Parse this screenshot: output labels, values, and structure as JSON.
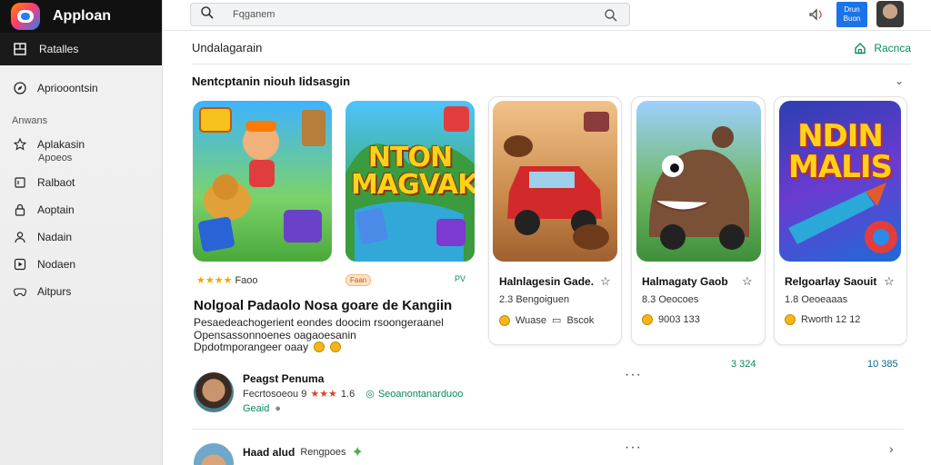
{
  "brand": {
    "name": "Apploan"
  },
  "search": {
    "placeholder": "Fqganem"
  },
  "topbar": {
    "button_label": "Drun\nBuon"
  },
  "sidebar": {
    "top": {
      "label": "Ratalles",
      "icon": "grid-icon"
    },
    "items": [
      {
        "label": "Apriooontsin",
        "icon": "compass-icon"
      }
    ],
    "section": "Anwans",
    "sub_items": [
      {
        "label": "Aplakasin",
        "sub": "Apoeos",
        "icon": "star-icon"
      },
      {
        "label": "Ralbaot",
        "icon": "bookmark-icon"
      },
      {
        "label": "Aoptain",
        "icon": "lock-icon"
      },
      {
        "label": "Nadain",
        "icon": "person-icon"
      },
      {
        "label": "Nodaen",
        "icon": "play-box-icon"
      },
      {
        "label": "Aitpurs",
        "icon": "gamepad-icon"
      }
    ]
  },
  "header": {
    "title": "Undalagarain",
    "action": "Racnca"
  },
  "section": {
    "title": "Nentcptanin niouh Iidsasgin",
    "more": "›"
  },
  "cards": [
    {
      "tile_text": "",
      "rating": "Faoo",
      "tag": ""
    },
    {
      "tile_text": "NTON\nMAGVAK",
      "tag": "Faan",
      "tag2": "PV"
    },
    {
      "tile_text": "",
      "title": "Halnlagesin Gade.",
      "sub": "2.3 Bengoiguen",
      "foot": "Wuase",
      "foot2": "Bscok"
    },
    {
      "tile_text": "",
      "title": "Halmagaty Gaob",
      "sub": "8.3 Oeocoes",
      "foot": "9003 133",
      "count": "3 324"
    },
    {
      "tile_text": "NDIN\nMALIS",
      "title": "Relgoarlay Saouit",
      "sub": "1.8 Oeoeaaas",
      "foot": "Rworth 12 12",
      "count": "10 385"
    }
  ],
  "featured": {
    "title": "Nolgoal Padaolo Nosa goare de Kangiin",
    "desc": "Pesaedeachogerient eondes doocim rsoongeraanel Opensassonnoenes oagaoesanin",
    "foot": "Dpdotmporangeer oaay"
  },
  "reviews": [
    {
      "name": "Peagst Penuma",
      "meta": "Fecrtosoeou 9",
      "rating": "1.6",
      "badge": "Seoanontanarduoo",
      "tag": "Geaid"
    },
    {
      "name": "Haad alud",
      "meta": "Rengpoes"
    }
  ],
  "colors": {
    "accent": "#1a73e8",
    "green": "#0a8a5a",
    "sidebar_dark": "#111111"
  }
}
